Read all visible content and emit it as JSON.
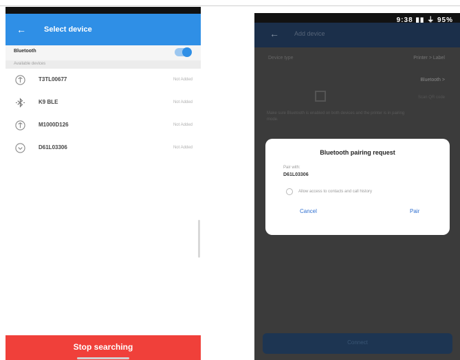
{
  "left_screen": {
    "app_bar": {
      "back_icon": "arrow-left-icon",
      "title": "Select device"
    },
    "bluetooth": {
      "label": "Bluetooth",
      "enabled": true
    },
    "section_header": "Available devices",
    "devices": [
      {
        "icon": "device-circle-icon",
        "name": "T3TL00677",
        "state": "Not Added"
      },
      {
        "icon": "bluetooth-icon",
        "name": "K9 BLE",
        "state": "Not Added"
      },
      {
        "icon": "device-circle-icon",
        "name": "M1000D126",
        "state": "Not Added"
      },
      {
        "icon": "device-circle-icon",
        "name": "D61L03306",
        "state": "Not Added"
      }
    ],
    "stop_button": "Stop searching"
  },
  "right_screen": {
    "status_bar": "9:38 ▮▮ ⏚ 95%",
    "app_bar": {
      "back_icon": "arrow-left-icon",
      "title": "Add device"
    },
    "row1": {
      "label": "Device type",
      "value": "Printer > Label"
    },
    "row2_value": "Bluetooth >",
    "row3_value": "Scan QR code",
    "note": "Make sure Bluetooth is enabled on both devices and the printer is in pairing mode.",
    "dialog": {
      "title": "Bluetooth pairing request",
      "pair_with_label": "Pair with:",
      "device": "D61L03306",
      "checkbox_label": "Allow access to contacts and call history",
      "cancel": "Cancel",
      "pair": "Pair"
    },
    "bottom_button": "Connect"
  },
  "colors": {
    "accent_blue": "#2f8fe6",
    "stop_red": "#f0403a",
    "dialog_link_blue": "#2f6fd0",
    "dark_overlay": "#3b3b3b"
  }
}
